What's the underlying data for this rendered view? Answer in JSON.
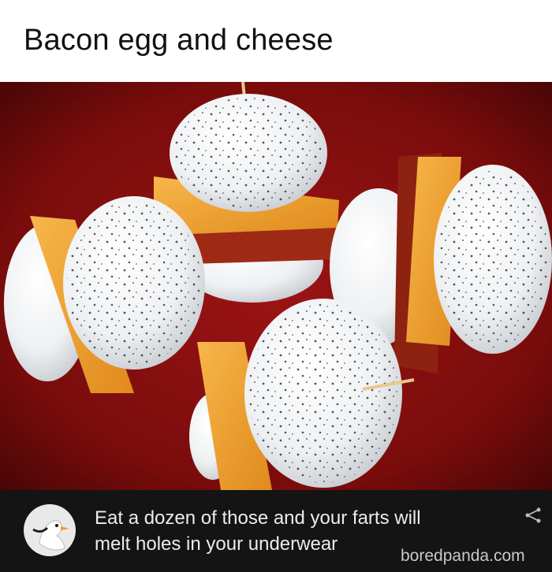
{
  "caption": {
    "text": "Bacon egg and cheese"
  },
  "photo": {
    "subject": "halved boiled eggs filled with cheddar cheese and bacon on toothpicks",
    "background_color": "#7a0c0c"
  },
  "comment": {
    "avatar_icon": "goose-avatar-icon",
    "line1": "Eat a dozen of those and your farts will",
    "line2": "melt holes in your underwear",
    "share_icon": "share-icon"
  },
  "watermark": {
    "text": "boredpanda.com"
  }
}
